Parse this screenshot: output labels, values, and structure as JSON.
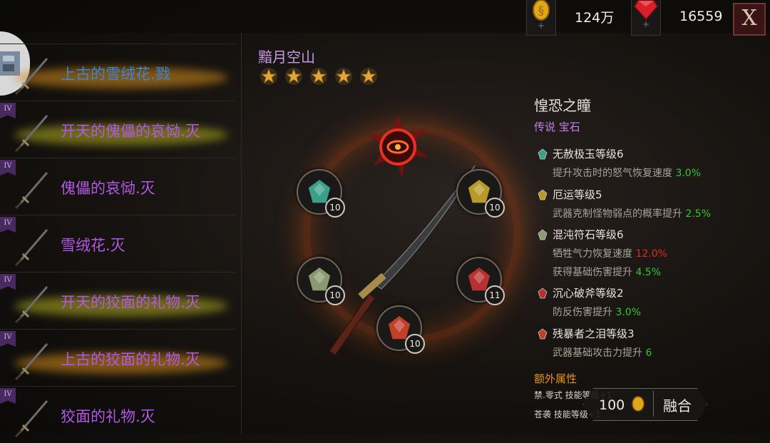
{
  "topbar": {
    "gold": {
      "icon": "gold-coin-icon",
      "value": "124万"
    },
    "gem": {
      "icon": "ruby-gem-icon",
      "value": "16559"
    },
    "close_label": "X"
  },
  "weapon_list": [
    {
      "name": "上古的雪绒花.戮",
      "color": "#3c86d6",
      "tier": "",
      "glow": "#c9861a"
    },
    {
      "name": "开天的傀儡的哀恸.灭",
      "color": "#b358e6",
      "tier": "IV",
      "glow": "#a9a61e"
    },
    {
      "name": "傀儡的哀恸.灭",
      "color": "#b358e6",
      "tier": "IV",
      "glow": ""
    },
    {
      "name": "雪绒花.灭",
      "color": "#b358e6",
      "tier": "IV",
      "glow": ""
    },
    {
      "name": "开天的狡面的礼物.灭",
      "color": "#b358e6",
      "tier": "IV",
      "glow": "#a9a61e"
    },
    {
      "name": "上古的狡面的礼物.灭",
      "color": "#b358e6",
      "tier": "IV",
      "glow": "#c9861a"
    },
    {
      "name": "狡面的礼物.灭",
      "color": "#b358e6",
      "tier": "IV",
      "glow": ""
    }
  ],
  "weapon": {
    "name": "黯月空山",
    "stars": 5
  },
  "sockets": [
    {
      "pos": "upper-left",
      "level": "10",
      "color": "#3aa08a"
    },
    {
      "pos": "upper-right",
      "level": "10",
      "color": "#b89a2a"
    },
    {
      "pos": "lower-left",
      "level": "10",
      "color": "#8a9a70"
    },
    {
      "pos": "lower-right",
      "level": "11",
      "color": "#b83030"
    },
    {
      "pos": "bottom",
      "level": "10",
      "color": "#c0402a"
    }
  ],
  "gem_info": {
    "name": "惶恐之瞳",
    "rarity": "传说 宝石",
    "stats": [
      {
        "name": "无赦极玉等级6",
        "lines": [
          [
            "提升攻击时的怒气恢复速度 ",
            "3.0%",
            "g"
          ]
        ]
      },
      {
        "name": "厄运等级5",
        "lines": [
          [
            "武器克制怪物弱点的概率提升 ",
            "2.5%",
            "g"
          ]
        ]
      },
      {
        "name": "混沌符石等级6",
        "lines": [
          [
            "牺牲气力恢复速度 ",
            "12.0%",
            "r"
          ],
          [
            "获得基础伤害提升 ",
            "4.5%",
            "g"
          ]
        ]
      },
      {
        "name": "沉心破斧等级2",
        "lines": [
          [
            "防反伤害提升 ",
            "3.0%",
            "g"
          ]
        ]
      },
      {
        "name": "残暴者之泪等级3",
        "lines": [
          [
            "武器基础攻击力提升 ",
            "6",
            "g"
          ]
        ]
      }
    ],
    "extra_title": "额外属性",
    "extra_lines": [
      "禁.零式 技能等级+1",
      "苍袭 技能等级+1"
    ]
  },
  "fuse": {
    "cost": "100",
    "label": "融合",
    "cost_icon": "gold-coin-icon"
  }
}
